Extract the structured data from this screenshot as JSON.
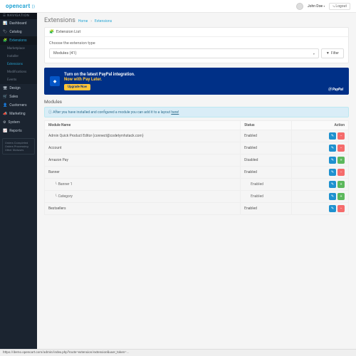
{
  "brand": "opencart",
  "user": {
    "name": "John Doe",
    "logout": "Logout"
  },
  "nav_header": "NAVIGATION",
  "nav": {
    "dashboard": "Dashboard",
    "catalog": "Catalog",
    "extensions": "Extensions",
    "sub": {
      "marketplace": "Marketplace",
      "installer": "Installer",
      "extensions": "Extensions",
      "modifications": "Modifications",
      "events": "Events"
    },
    "design": "Design",
    "sales": "Sales",
    "customers": "Customers",
    "marketing": "Marketing",
    "system": "System",
    "reports": "Reports"
  },
  "sidebar_box": {
    "l1": "Orders Completed",
    "l2": "Orders Processing",
    "l3": "Other Statuses"
  },
  "page": {
    "title": "Extensions",
    "crumb_home": "Home",
    "crumb_cur": "Extensions"
  },
  "panel_title": "Extension List",
  "choose_label": "Choose the extension type",
  "select_value": "Modules (41)",
  "filter_btn": "Filter",
  "promo": {
    "line1": "Turn on the latest PayPal integration.",
    "line2": "Now with Pay Later.",
    "cta": "Upgrade Now",
    "brand": "PayPal"
  },
  "section_title": "Modules",
  "info_text": "After you have installed and configured a module you can add it to a layout ",
  "info_link": "here!",
  "cols": {
    "name": "Module Name",
    "status": "Status",
    "action": "Action"
  },
  "rows": [
    {
      "name": "Admin Quick Product Editor (connect@codetymhstack.com)",
      "status": "Enabled",
      "type": "edit-del"
    },
    {
      "name": "Account",
      "status": "Enabled",
      "type": "edit-del"
    },
    {
      "name": "Amazon Pay",
      "status": "Disabled",
      "type": "edit-inst"
    },
    {
      "name": "Banner",
      "status": "Enabled",
      "type": "edit-del"
    },
    {
      "name": "Banner 1",
      "status": "Enabled",
      "type": "edit-only",
      "sub": true
    },
    {
      "name": "Category",
      "status": "Enabled",
      "type": "edit-only",
      "sub": true
    },
    {
      "name": "Bestsellers",
      "status": "Enabled",
      "type": "edit-del"
    }
  ],
  "status_url": "https://demo.opencart.com/admin/index.php?route=extension/extension&user_token=..."
}
